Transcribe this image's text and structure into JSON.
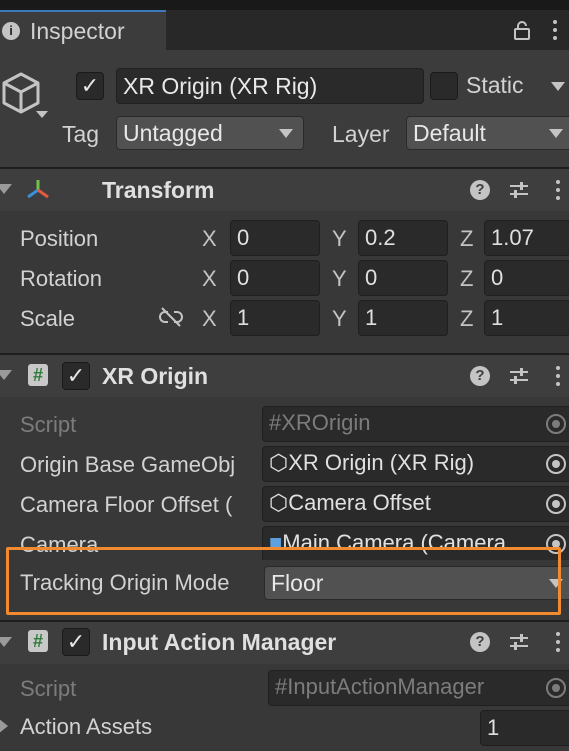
{
  "window": {
    "tab_label": "Inspector",
    "tab_icon": "info-icon",
    "lock_icon": "lock-icon",
    "menu_icon": "kebab-menu-icon"
  },
  "gameobject": {
    "active": true,
    "name": "XR Origin (XR Rig)",
    "static_label": "Static",
    "static_checked": false,
    "tag_label": "Tag",
    "tag_value": "Untagged",
    "layer_label": "Layer",
    "layer_value": "Default"
  },
  "transform": {
    "title": "Transform",
    "rows": [
      {
        "label": "Position",
        "x": "0",
        "y": "0.2",
        "z": "1.07"
      },
      {
        "label": "Rotation",
        "x": "0",
        "y": "0",
        "z": "0"
      },
      {
        "label": "Scale",
        "x": "1",
        "y": "1",
        "z": "1"
      }
    ],
    "axis_x": "X",
    "axis_y": "Y",
    "axis_z": "Z"
  },
  "xr_origin": {
    "title": "XR Origin",
    "enabled": true,
    "script_label": "Script",
    "script_value": "XROrigin",
    "origin_base_label": "Origin Base GameObj",
    "origin_base_value": "XR Origin (XR Rig)",
    "camera_floor_label": "Camera Floor Offset (",
    "camera_floor_value": "Camera Offset",
    "camera_label": "Camera",
    "camera_value": "Main Camera (Camera",
    "tracking_label": "Tracking Origin Mode",
    "tracking_value": "Floor"
  },
  "input_action_manager": {
    "title": "Input Action Manager",
    "enabled": true,
    "script_label": "Script",
    "script_value": "InputActionManager",
    "action_assets_label": "Action Assets",
    "action_assets_count": "1"
  },
  "colors": {
    "highlight": "#f28a30",
    "accent": "#3a79bb"
  }
}
